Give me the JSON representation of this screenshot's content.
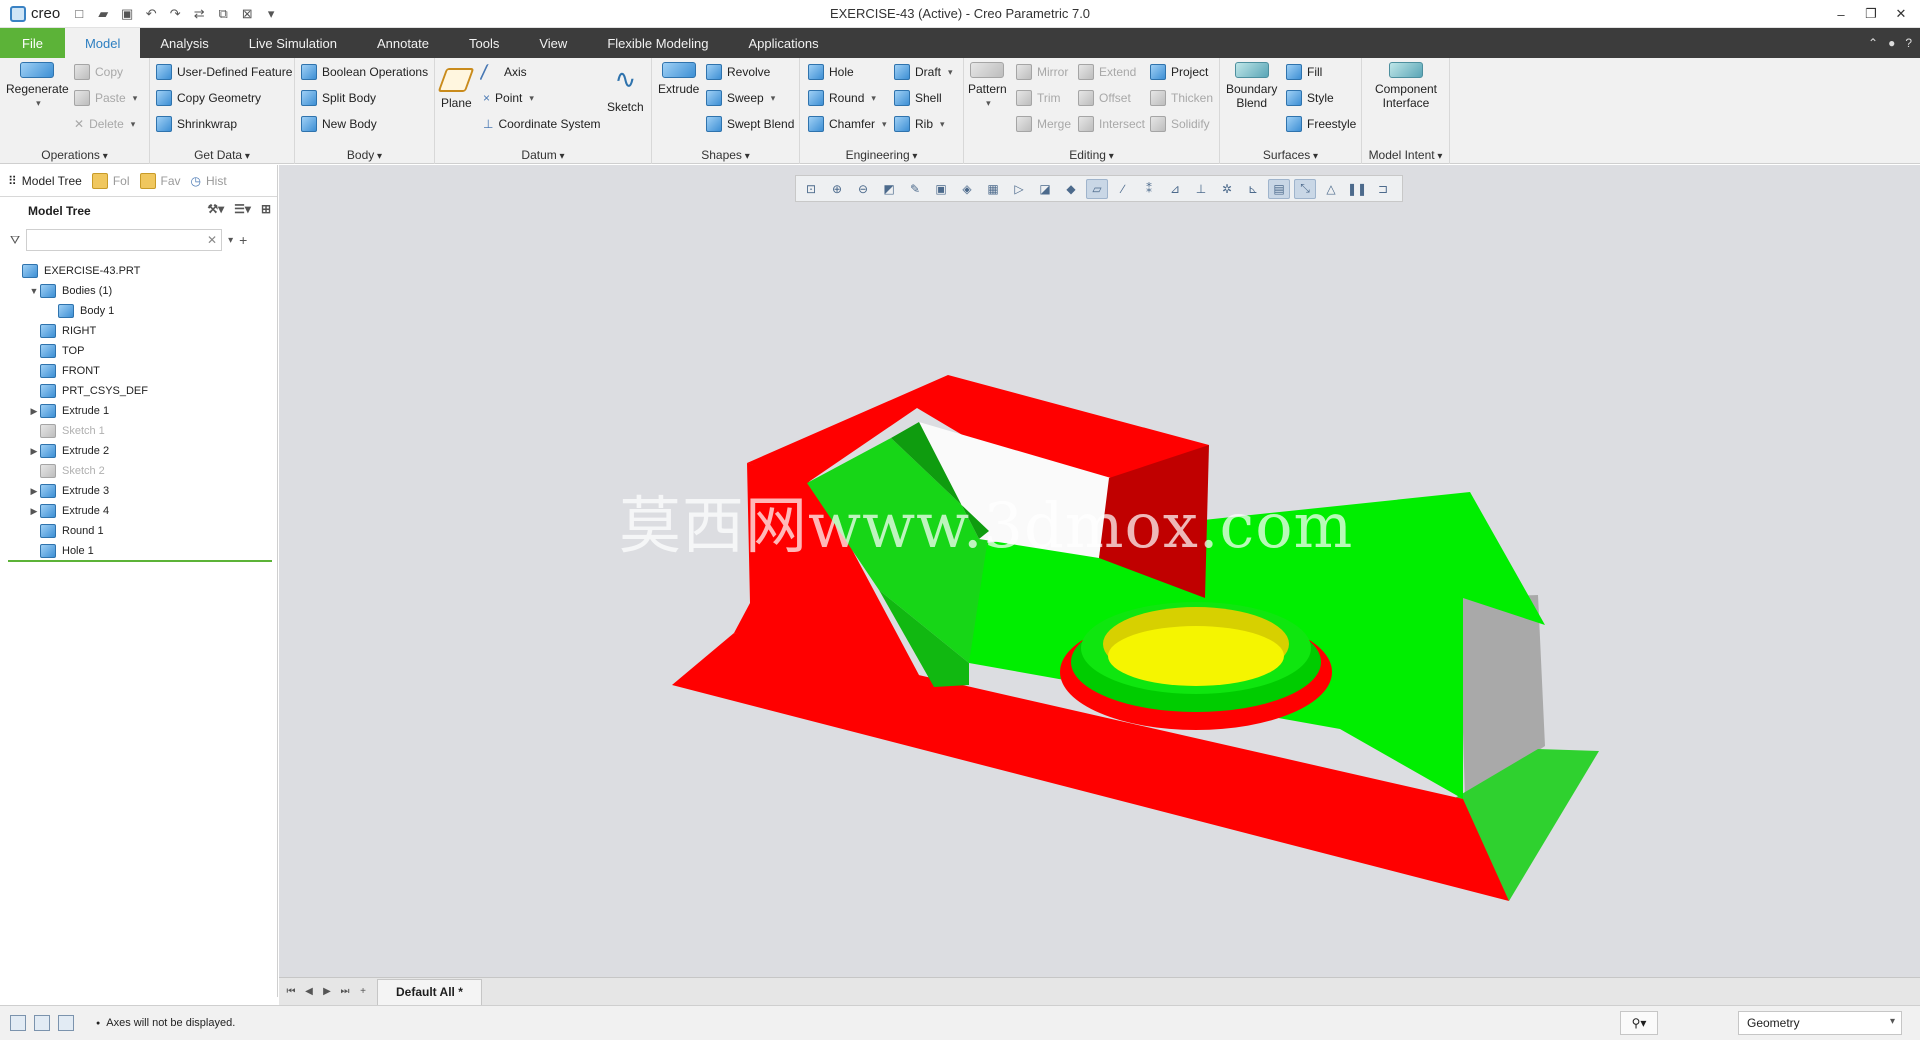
{
  "app": {
    "brand": "creo",
    "title": "EXERCISE-43 (Active) - Creo Parametric 7.0"
  },
  "tabs": [
    "File",
    "Model",
    "Analysis",
    "Live Simulation",
    "Annotate",
    "Tools",
    "View",
    "Flexible Modeling",
    "Applications"
  ],
  "ribbon": {
    "operations": {
      "label": "Operations",
      "regenerate": "Regenerate",
      "copy": "Copy",
      "paste": "Paste",
      "delete": "Delete"
    },
    "get_data": {
      "label": "Get Data",
      "udf": "User-Defined Feature",
      "copy_geometry": "Copy Geometry",
      "shrinkwrap": "Shrinkwrap"
    },
    "body": {
      "label": "Body",
      "boolean": "Boolean Operations",
      "split": "Split Body",
      "new": "New Body"
    },
    "datum": {
      "label": "Datum",
      "plane": "Plane",
      "axis": "Axis",
      "point": "Point",
      "csys": "Coordinate System",
      "sketch": "Sketch"
    },
    "shapes": {
      "label": "Shapes",
      "extrude": "Extrude",
      "revolve": "Revolve",
      "sweep": "Sweep",
      "swept_blend": "Swept Blend"
    },
    "engineering": {
      "label": "Engineering",
      "hole": "Hole",
      "round": "Round",
      "chamfer": "Chamfer",
      "draft": "Draft",
      "shell": "Shell",
      "rib": "Rib"
    },
    "editing": {
      "label": "Editing",
      "pattern": "Pattern",
      "mirror": "Mirror",
      "trim": "Trim",
      "merge": "Merge",
      "extend": "Extend",
      "offset": "Offset",
      "intersect": "Intersect",
      "project": "Project",
      "thicken": "Thicken",
      "solidify": "Solidify"
    },
    "surfaces": {
      "label": "Surfaces",
      "boundary_blend": "Boundary\nBlend",
      "fill": "Fill",
      "style": "Style",
      "freestyle": "Freestyle"
    },
    "model_intent": {
      "label": "Model Intent",
      "component_interface": "Component\nInterface"
    }
  },
  "navigator": {
    "tabs": [
      "Model Tree",
      "Fol",
      "Fav",
      "Hist"
    ],
    "tree_title": "Model Tree",
    "items": [
      {
        "label": "EXERCISE-43.PRT",
        "level": 0,
        "expander": "",
        "dim": false
      },
      {
        "label": "Bodies (1)",
        "level": 1,
        "expander": "▼",
        "dim": false
      },
      {
        "label": "Body 1",
        "level": 2,
        "expander": "",
        "dim": false
      },
      {
        "label": "RIGHT",
        "level": 1,
        "expander": "",
        "dim": false
      },
      {
        "label": "TOP",
        "level": 1,
        "expander": "",
        "dim": false
      },
      {
        "label": "FRONT",
        "level": 1,
        "expander": "",
        "dim": false
      },
      {
        "label": "PRT_CSYS_DEF",
        "level": 1,
        "expander": "",
        "dim": false
      },
      {
        "label": "Extrude 1",
        "level": 1,
        "expander": "▶",
        "dim": false
      },
      {
        "label": "Sketch 1",
        "level": 1,
        "expander": "",
        "dim": true
      },
      {
        "label": "Extrude 2",
        "level": 1,
        "expander": "▶",
        "dim": false
      },
      {
        "label": "Sketch 2",
        "level": 1,
        "expander": "",
        "dim": true
      },
      {
        "label": "Extrude 3",
        "level": 1,
        "expander": "▶",
        "dim": false
      },
      {
        "label": "Extrude 4",
        "level": 1,
        "expander": "▶",
        "dim": false
      },
      {
        "label": "Round 1",
        "level": 1,
        "expander": "",
        "dim": false
      },
      {
        "label": "Hole 1",
        "level": 1,
        "expander": "",
        "dim": false
      }
    ]
  },
  "graphics": {
    "watermark": "莫西网www.3dmox.com",
    "colors": {
      "red": "#ff0000",
      "green": "#00ee00",
      "yellow": "#f5f500",
      "white": "#ececec",
      "grey": "#a9a9a9",
      "background": "#dcdde1"
    }
  },
  "viewbar": {
    "tab": "Default All *"
  },
  "status": {
    "message": "Axes will not be displayed.",
    "selection_filter": "Geometry"
  }
}
